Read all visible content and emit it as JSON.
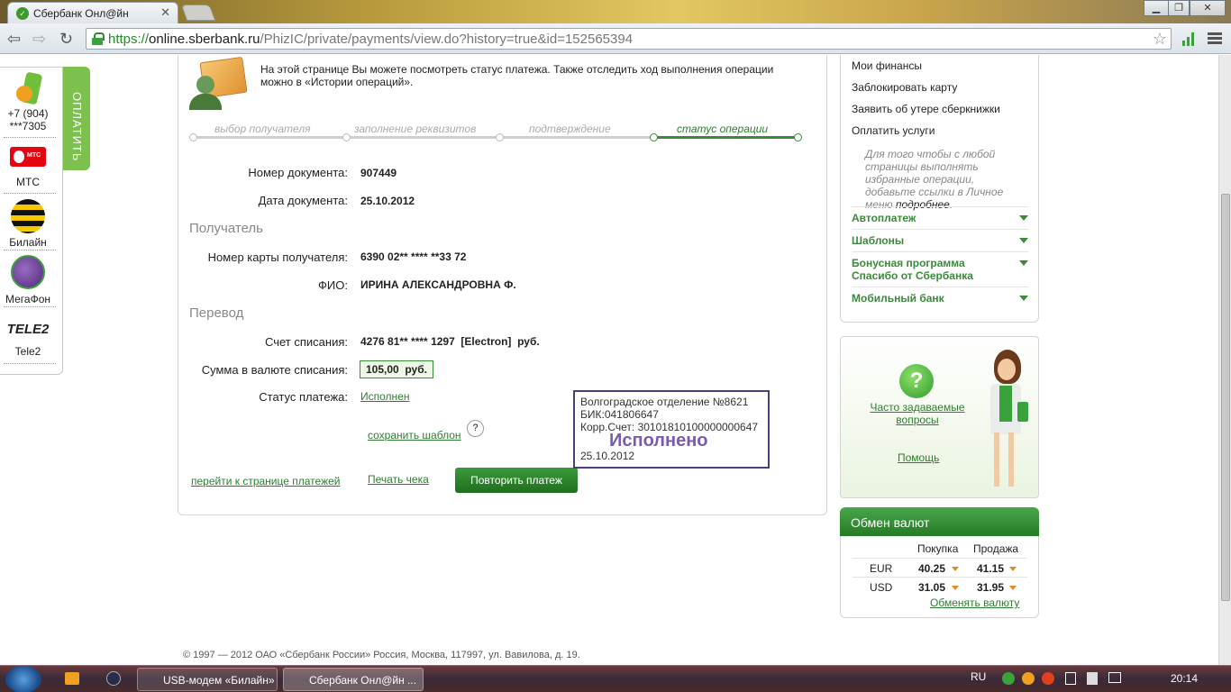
{
  "browser": {
    "tab_title": "Сбербанк Онл@йн",
    "url_scheme": "https://",
    "url_host": "online.sberbank.ru",
    "url_path": "/PhizIC/private/payments/view.do?history=true&id=152565394"
  },
  "quick_pay": {
    "tab_label": "ОПЛАТИТЬ",
    "items": [
      {
        "label": "+7 (904)\n***7305",
        "icon": "phone-icon"
      },
      {
        "label": "МТС",
        "icon": "mts-logo"
      },
      {
        "label": "Билайн",
        "icon": "beeline-logo"
      },
      {
        "label": "МегаФон",
        "icon": "megafon-logo"
      },
      {
        "label": "Tele2",
        "icon": "tele2-logo"
      }
    ],
    "mts_text": "МТС",
    "tele2_text": "TELE2"
  },
  "main": {
    "intro": "На этой странице Вы можете посмотреть статус платежа. Также отследить ход выполнения операции можно в «Истории операций».",
    "steps": [
      "выбор получателя",
      "заполнение реквизитов",
      "подтверждение",
      "статус операции"
    ],
    "doc_number_label": "Номер документа:",
    "doc_number": "907449",
    "doc_date_label": "Дата документа:",
    "doc_date": "25.10.2012",
    "recipient_section": "Получатель",
    "card_label": "Номер карты получателя:",
    "card_value": "6390 02** **** **33 72",
    "fio_label": "ФИО:",
    "fio_value": "ИРИНА АЛЕКСАНДРОВНА Ф.",
    "transfer_section": "Перевод",
    "account_label": "Счет списания:",
    "account_value": "4276 81** **** 1297  [Electron]  руб.",
    "amount_label": "Сумма в валюте списания:",
    "amount_value": "105,00  руб.",
    "status_label": "Статус платежа:",
    "status_value": "Исполнен",
    "save_template": "сохранить шаблон",
    "help_q": "?",
    "stamp": {
      "line1": "Волгоградское отделение №8621",
      "line2": "БИК:041806647",
      "line3": "Корр.Счет: 30101810100000000647",
      "mark": "Исполнено",
      "date": "25.10.2012"
    },
    "go_payments": "перейти к странице платежей",
    "print_receipt": "Печать чека",
    "repeat_button": "Повторить платеж",
    "footer": "© 1997 — 2012 ОАО «Сбербанк России» Россия, Москва, 117997, ул. Вавилова, д. 19."
  },
  "right": {
    "menu": [
      "Мои финансы",
      "Заблокировать карту",
      "Заявить об утере сберкнижки",
      "Оплатить услуги"
    ],
    "hint_pre": "Для того чтобы с любой страницы выполнять избранные операции, добавьте ссылки в Личное меню ",
    "hint_link": "подробнее",
    "hint_post": ".",
    "accordions": [
      "Автоплатеж",
      "Шаблоны",
      "Бонусная программа Спасибо от Сбербанка",
      "Мобильный банк"
    ],
    "faq": "Часто задаваемые вопросы",
    "faq_icon": "?",
    "help": "Помощь",
    "fx": {
      "title": "Обмен валют",
      "buy": "Покупка",
      "sell": "Продажа",
      "rows": [
        {
          "cur": "EUR",
          "buy": "40.25",
          "sell": "41.15"
        },
        {
          "cur": "USD",
          "buy": "31.05",
          "sell": "31.95"
        }
      ],
      "exchange_link": "Обменять валюту"
    }
  },
  "taskbar": {
    "items": [
      "USB-модем «Билайн»",
      "Сбербанк Онл@йн ..."
    ],
    "lang": "RU",
    "time": "20:14"
  },
  "colors": {
    "accent": "#2e7d32",
    "brand_green": "#3a8a3a",
    "button": "#257a25"
  }
}
